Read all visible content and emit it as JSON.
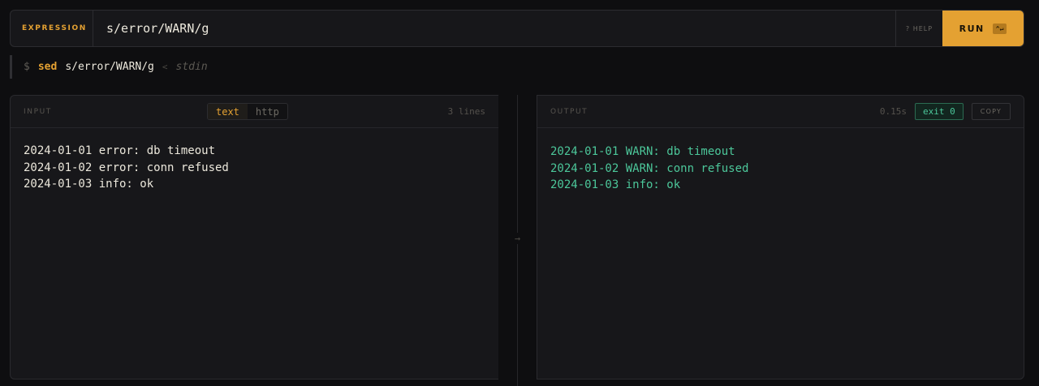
{
  "expression": {
    "label": "EXPRESSION",
    "value": "s/error/WARN/g",
    "help_label": "? HELP",
    "run_label": "RUN",
    "run_shortcut": "^↵"
  },
  "command": {
    "prompt": "$",
    "name": "sed",
    "argument": "s/error/WARN/g",
    "redirect": "<",
    "source": "stdin"
  },
  "input_panel": {
    "title": "INPUT",
    "tabs": [
      {
        "label": "text",
        "active": true
      },
      {
        "label": "http",
        "active": false
      }
    ],
    "line_count": "3 lines",
    "lines": [
      "2024-01-01 error: db timeout",
      "2024-01-02 error: conn refused",
      "2024-01-03 info: ok"
    ]
  },
  "flow_arrow": "→",
  "output_panel": {
    "title": "OUTPUT",
    "timing": "0.15s",
    "exit_status": "exit 0",
    "copy_label": "COPY",
    "lines": [
      "2024-01-01 WARN: db timeout",
      "2024-01-02 WARN: conn refused",
      "2024-01-03 info: ok"
    ]
  },
  "colors": {
    "accent": "#e4a132",
    "success": "#4cc79a",
    "background": "#0e0e10",
    "panel": "#17171a"
  },
  "icons": [
    "help-icon",
    "arrow-right-icon",
    "enter-key-icon"
  ]
}
